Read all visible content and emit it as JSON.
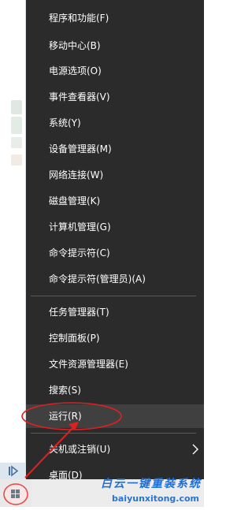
{
  "menu": {
    "group1": [
      {
        "label": "程序和功能(F)"
      },
      {
        "label": "移动中心(B)"
      },
      {
        "label": "电源选项(O)"
      },
      {
        "label": "事件查看器(V)"
      },
      {
        "label": "系统(Y)"
      },
      {
        "label": "设备管理器(M)"
      },
      {
        "label": "网络连接(W)"
      },
      {
        "label": "磁盘管理(K)"
      },
      {
        "label": "计算机管理(G)"
      },
      {
        "label": "命令提示符(C)"
      },
      {
        "label": "命令提示符(管理员)(A)"
      }
    ],
    "group2": [
      {
        "label": "任务管理器(T)"
      },
      {
        "label": "控制面板(P)"
      },
      {
        "label": "文件资源管理器(E)"
      },
      {
        "label": "搜索(S)"
      },
      {
        "label": "运行(R)"
      }
    ],
    "group3": [
      {
        "label": "关机或注销(U)"
      },
      {
        "label": "桌面(D)"
      }
    ]
  },
  "watermark": {
    "title": "白云一键重装系统",
    "url": "baiyunxitong.com"
  },
  "colors": {
    "menu_bg": "#2b2b2b",
    "highlight": "#404040",
    "annotation": "#e02020",
    "watermark": "#1e6fd9"
  },
  "icons": [
    "chevron-right-icon",
    "windows-logo-icon",
    "panel-toggle-icon",
    "annotation-arrow-icon"
  ]
}
